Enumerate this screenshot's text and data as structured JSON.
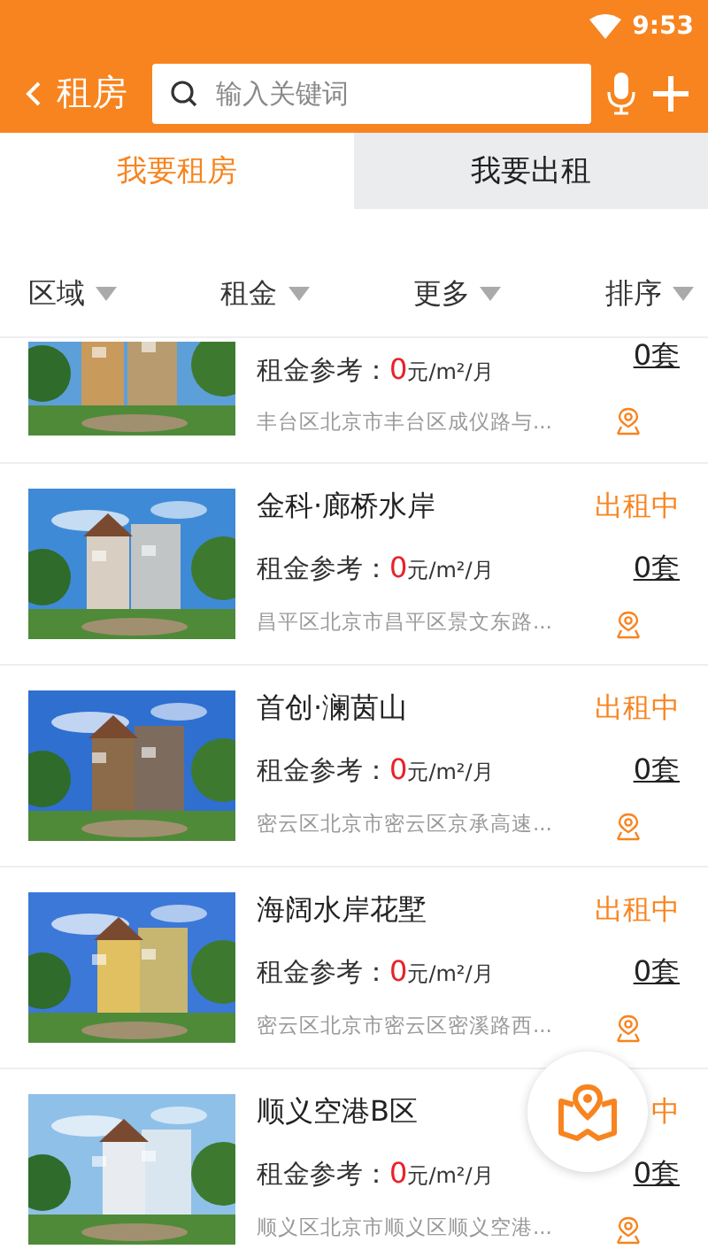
{
  "status_bar": {
    "time": "9:53"
  },
  "header": {
    "title": "租房",
    "search": {
      "placeholder": "输入关键词"
    }
  },
  "tabs": [
    {
      "label": "我要租房",
      "selected": true
    },
    {
      "label": "我要出租",
      "selected": false
    }
  ],
  "filters": [
    {
      "label": "区域"
    },
    {
      "label": "租金"
    },
    {
      "label": "更多"
    },
    {
      "label": "排序"
    }
  ],
  "listings": [
    {
      "kind": "partial",
      "rent_label": "租金参考：",
      "rent_value": "0",
      "rent_unit": "元/m²/月",
      "address": "丰台区北京市丰台区成仪路与...",
      "count": "0套"
    },
    {
      "kind": "full",
      "title": "金科·廊桥水岸",
      "status": "出租中",
      "rent_label": "租金参考：",
      "rent_value": "0",
      "rent_unit": "元/m²/月",
      "address": "昌平区北京市昌平区景文东路...",
      "count": "0套"
    },
    {
      "kind": "full",
      "title": "首创·澜茵山",
      "status": "出租中",
      "rent_label": "租金参考：",
      "rent_value": "0",
      "rent_unit": "元/m²/月",
      "address": "密云区北京市密云区京承高速...",
      "count": "0套"
    },
    {
      "kind": "full",
      "title": "海阔水岸花墅",
      "status": "出租中",
      "rent_label": "租金参考：",
      "rent_value": "0",
      "rent_unit": "元/m²/月",
      "address": "密云区北京市密云区密溪路西...",
      "count": "0套"
    },
    {
      "kind": "full",
      "title": "顺义空港B区",
      "status": "中",
      "rent_label": "租金参考：",
      "rent_value": "0",
      "rent_unit": "元/m²/月",
      "address": "顺义区北京市顺义区顺义空港...",
      "count": "0套"
    }
  ]
}
